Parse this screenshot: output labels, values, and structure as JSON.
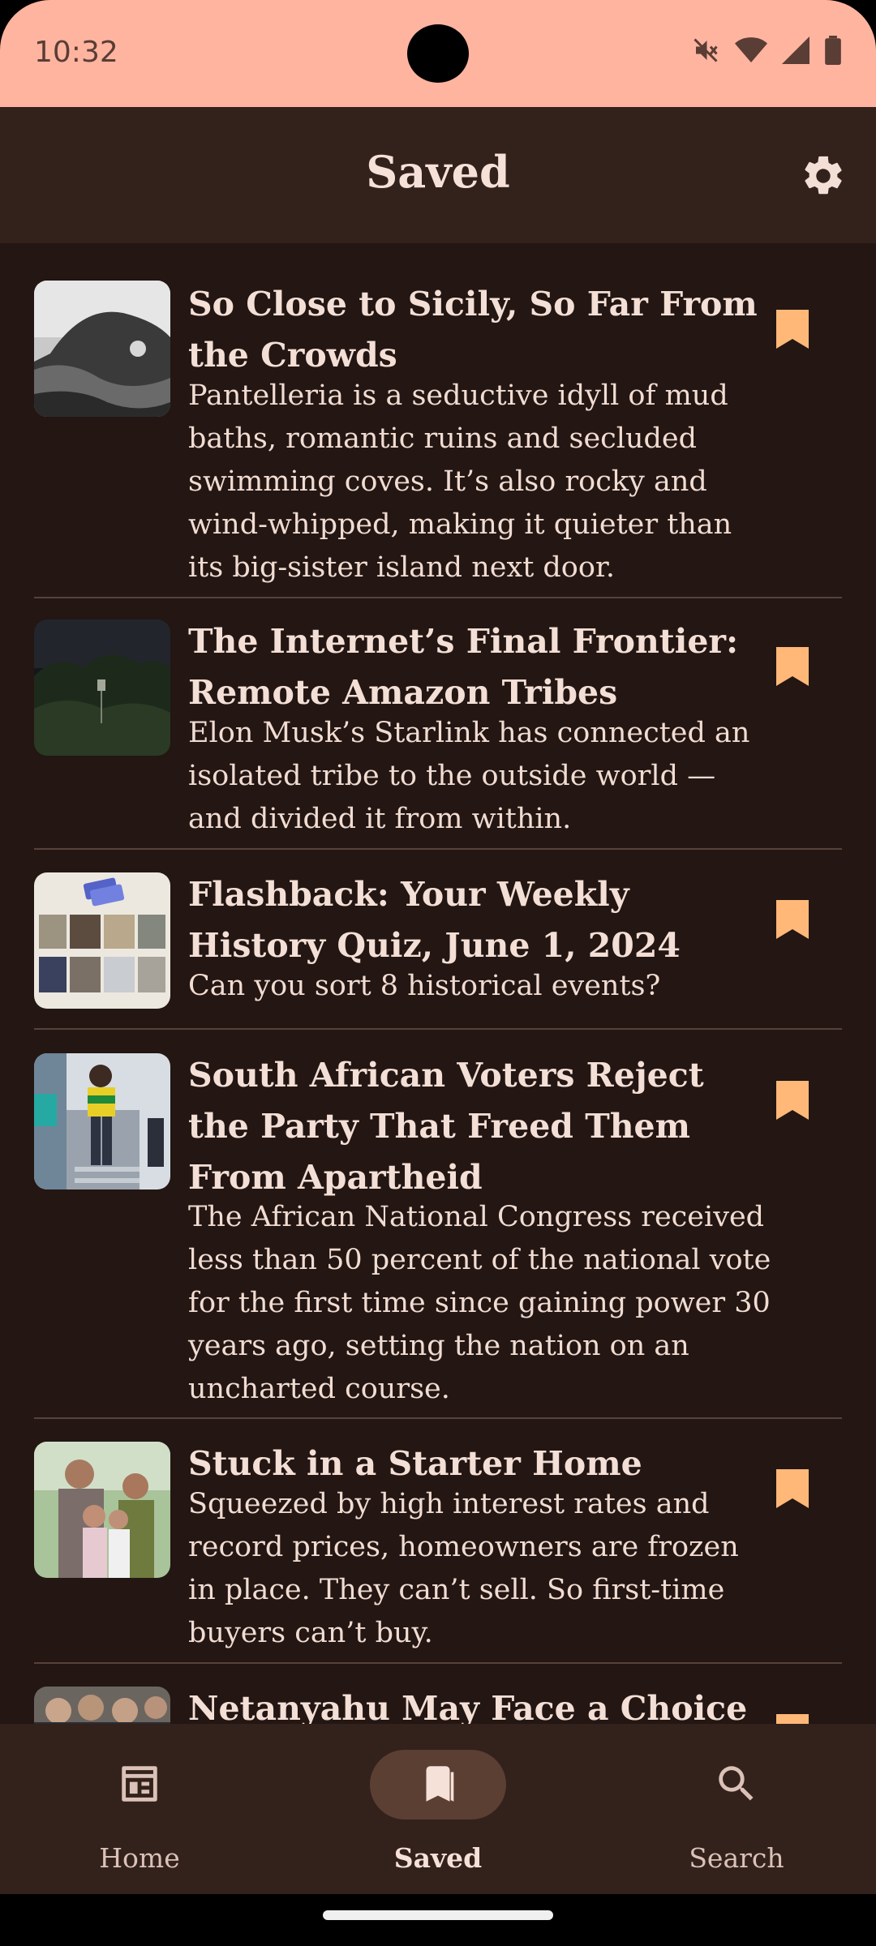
{
  "status_bar": {
    "time": "10:32"
  },
  "app_bar": {
    "title": "Saved"
  },
  "articles": [
    {
      "title": "So Close to Sicily, So Far From the Crowds",
      "summary": "Pantelleria is a seductive idyll of mud baths, romantic ruins and secluded swimming coves. It’s also rocky and wind-whipped, making it quieter than its big-sister island next door."
    },
    {
      "title": "The Internet’s Final Frontier: Remote Amazon Tribes",
      "summary": "Elon Musk’s Starlink has connected an isolated tribe to the outside world — and divided it from within."
    },
    {
      "title": "Flashback: Your Weekly History Quiz, June 1, 2024",
      "summary": "Can you sort 8 historical events?"
    },
    {
      "title": "South African Voters Reject the Party That Freed Them From Apartheid",
      "summary": "The African National Congress received less than 50 percent of the national vote for the first time since gaining power 30 years ago, setting the nation on an uncharted course."
    },
    {
      "title": "Stuck in a Starter Home",
      "summary": "Squeezed by high interest rates and record prices, homeowners are frozen in place. They can’t sell. So first-time buyers can’t buy."
    },
    {
      "title": "Netanyahu May Face a Choice",
      "summary": ""
    }
  ],
  "bottom_nav": {
    "items": [
      {
        "label": "Home",
        "icon": "newspaper-icon",
        "active": false
      },
      {
        "label": "Saved",
        "icon": "bookmarks-icon",
        "active": true
      },
      {
        "label": "Search",
        "icon": "search-icon",
        "active": false
      }
    ]
  },
  "colors": {
    "status_bar": "#ffb4a0",
    "app_bar": "#33211c",
    "background": "#231613",
    "bookmark": "#ffb878",
    "divider": "#57423b"
  }
}
